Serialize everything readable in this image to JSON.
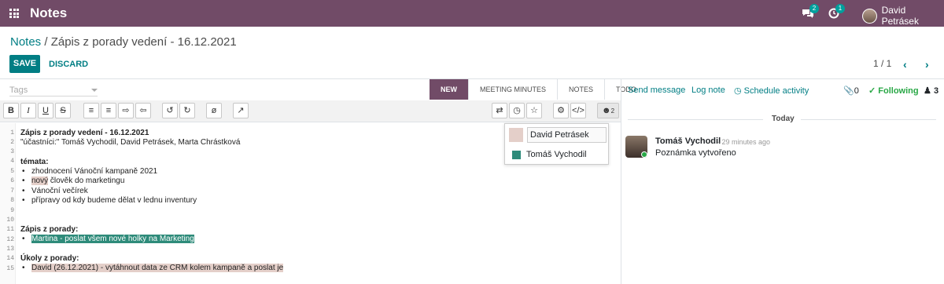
{
  "topbar": {
    "app_name": "Notes",
    "messages_count": "2",
    "activities_count": "1",
    "user_name": "David Petrásek"
  },
  "breadcrumb": {
    "parent": "Notes",
    "separator": " / ",
    "current": "Zápis z porady vedení - 16.12.2021"
  },
  "actions": {
    "save": "SAVE",
    "discard": "DISCARD"
  },
  "pager": {
    "text": "1 / 1"
  },
  "tags": {
    "placeholder": "Tags"
  },
  "stages": [
    "NEW",
    "MEETING MINUTES",
    "NOTES",
    "TODO"
  ],
  "editor_lines": {
    "title": "Zápis z porady vedení - 16.12.2021",
    "attendees": "\"účastníci:\" Tomáš Vychodil, David Petrásek, Marta Chrástková",
    "topics_heading": "témata:",
    "topic_1": "zhodnocení Vánoční kampaně 2021",
    "topic_2_hl": "nový",
    "topic_2_rest": " člověk do marketingu",
    "topic_3": "Vánoční večírek",
    "topic_4": "přípravy od kdy budeme dělat v lednu inventury",
    "minutes_heading": "Zápis z porady:",
    "minutes_1": "Martina - poslat všem nové holky na Marketing",
    "tasks_heading": "Úkoly z porady:",
    "task_1": "David (26.12.2021) - vytáhnout data ze CRM kolem kampaně a poslat je"
  },
  "line_numbers": [
    "1",
    "2",
    "3",
    "4",
    "5",
    "6",
    "7",
    "8",
    "9",
    "10",
    "11",
    "12",
    "13",
    "14",
    "15"
  ],
  "collab_count": "2",
  "collaborators": [
    {
      "name": "David Petrásek",
      "color": "#e4cfc9"
    },
    {
      "name": "Tomáš Vychodil",
      "color": "#2e8b7a"
    }
  ],
  "chatter": {
    "send_message": "Send message",
    "log_note": "Log note",
    "schedule_activity": "Schedule activity",
    "attachments": "0",
    "following": "Following",
    "followers": "3",
    "today": "Today",
    "message": {
      "author": "Tomáš Vychodil",
      "time": "- 29 minutes ago",
      "body": "Poznámka vytvořeno"
    }
  }
}
